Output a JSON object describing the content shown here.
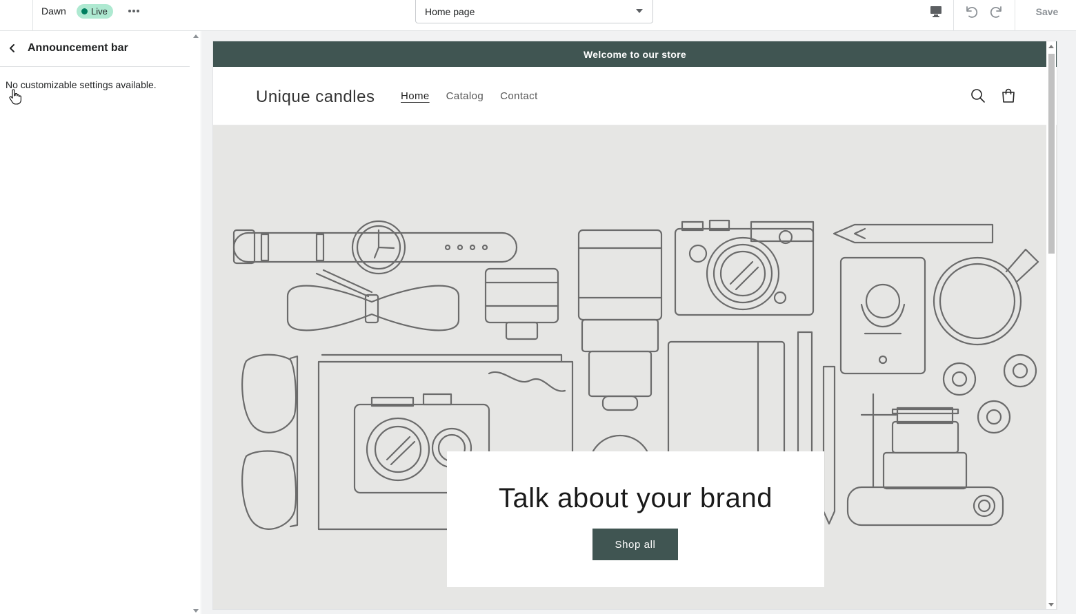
{
  "topbar": {
    "theme_name": "Dawn",
    "status_badge": "Live",
    "page_selector_value": "Home page",
    "save_label": "Save",
    "icons": {
      "more": "more-horizontal-icon",
      "device": "desktop-icon",
      "undo": "undo-icon",
      "redo": "redo-icon"
    }
  },
  "sidebar": {
    "title": "Announcement bar",
    "message": "No customizable settings available.",
    "back_icon": "chevron-left-icon"
  },
  "preview": {
    "announcement": "Welcome to our store",
    "store_name": "Unique candles",
    "nav": [
      {
        "label": "Home",
        "active": true
      },
      {
        "label": "Catalog",
        "active": false
      },
      {
        "label": "Contact",
        "active": false
      }
    ],
    "hero": {
      "heading": "Talk about your brand",
      "button_label": "Shop all"
    }
  },
  "colors": {
    "accent": "#405552",
    "badge_bg": "#aee9d1",
    "badge_dot": "#007f5f",
    "hero_bg": "#e6e6e4"
  }
}
